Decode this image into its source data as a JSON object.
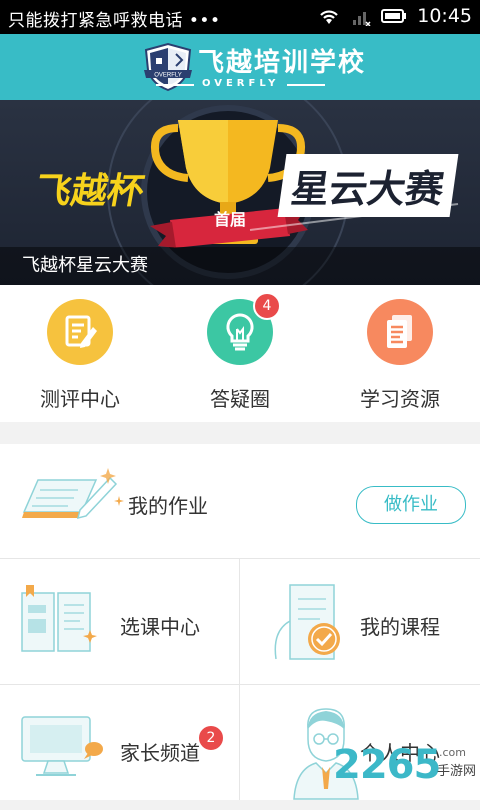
{
  "status_bar": {
    "carrier": "只能拨打紧急呼救电话 •••",
    "time": "10:45"
  },
  "header": {
    "school_name": "飞越培训学校",
    "brand": "OVERFLY"
  },
  "banner": {
    "art_left": "飞越杯",
    "art_right": "星云大赛",
    "art_ribbon": "首届",
    "caption": "飞越杯星云大赛"
  },
  "quick_menu": [
    {
      "label": "测评中心",
      "icon": "pencil-note-icon",
      "color": "#f6c23e"
    },
    {
      "label": "答疑圈",
      "icon": "lightbulb-icon",
      "color": "#3cc7a3",
      "badge": "4"
    },
    {
      "label": "学习资源",
      "icon": "documents-icon",
      "color": "#f7895f"
    }
  ],
  "homework": {
    "label": "我的作业",
    "button": "做作业"
  },
  "grid": [
    {
      "label": "选课中心",
      "icon": "open-book-icon"
    },
    {
      "label": "我的课程",
      "icon": "course-certificate-icon"
    },
    {
      "label": "家长频道",
      "icon": "monitor-chat-icon",
      "badge": "2"
    },
    {
      "label": "个人中心",
      "icon": "person-icon"
    }
  ],
  "watermark": {
    "number": "2265",
    "suffix": ".com",
    "site": "手游网"
  },
  "colors": {
    "accent": "#38bcc6",
    "badge": "#e94a4a"
  }
}
